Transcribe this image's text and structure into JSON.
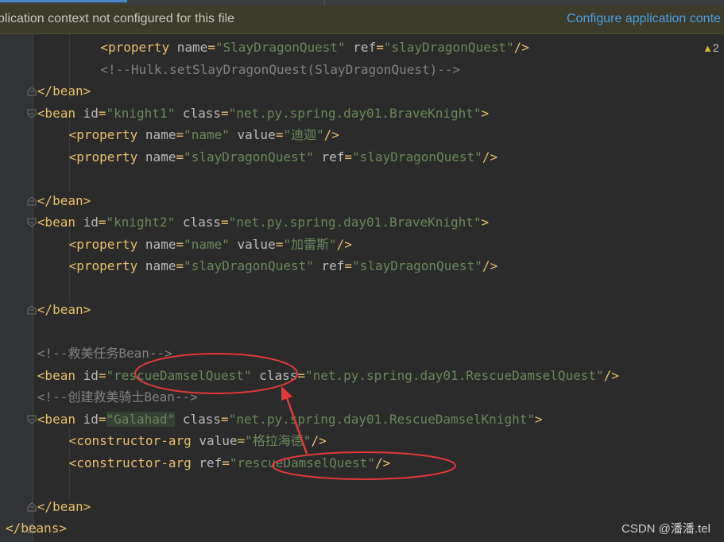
{
  "banner": {
    "message": "plication context not configured for this file",
    "action": "Configure application conte"
  },
  "inspection": {
    "count": "2",
    "icon": "warning-triangle-icon"
  },
  "code_lines": [
    {
      "indent": 6,
      "tokens": [
        [
          "tag",
          "<property "
        ],
        [
          "attr",
          "name"
        ],
        [
          "tag",
          "="
        ],
        [
          "str",
          "\"SlayDragonQuest\""
        ],
        [
          "tag",
          " "
        ],
        [
          "attr",
          "ref"
        ],
        [
          "tag",
          "="
        ],
        [
          "str",
          "\"slayDragonQuest\""
        ],
        [
          "tag",
          "/>"
        ]
      ]
    },
    {
      "indent": 6,
      "tokens": [
        [
          "cmt",
          "<!--Hulk.setSlayDragonQuest(SlayDragonQuest)-->"
        ]
      ]
    },
    {
      "indent": 2,
      "tokens": [
        [
          "tag",
          "</bean>"
        ]
      ]
    },
    {
      "indent": 2,
      "tokens": [
        [
          "tag",
          "<bean "
        ],
        [
          "attr",
          "id"
        ],
        [
          "tag",
          "="
        ],
        [
          "str",
          "\"knight1\""
        ],
        [
          "tag",
          " "
        ],
        [
          "attr",
          "class"
        ],
        [
          "tag",
          "="
        ],
        [
          "str",
          "\"net.py.spring.day01.BraveKnight\""
        ],
        [
          "tag",
          ">"
        ]
      ]
    },
    {
      "indent": 4,
      "tokens": [
        [
          "tag",
          "<property "
        ],
        [
          "attr",
          "name"
        ],
        [
          "tag",
          "="
        ],
        [
          "str",
          "\"name\""
        ],
        [
          "tag",
          " "
        ],
        [
          "attr",
          "value"
        ],
        [
          "tag",
          "="
        ],
        [
          "str",
          "\"迪迦\""
        ],
        [
          "tag",
          "/>"
        ]
      ]
    },
    {
      "indent": 4,
      "tokens": [
        [
          "tag",
          "<property "
        ],
        [
          "attr",
          "name"
        ],
        [
          "tag",
          "="
        ],
        [
          "str",
          "\"slayDragonQuest\""
        ],
        [
          "tag",
          " "
        ],
        [
          "attr",
          "ref"
        ],
        [
          "tag",
          "="
        ],
        [
          "str",
          "\"slayDragonQuest\""
        ],
        [
          "tag",
          "/>"
        ]
      ]
    },
    {
      "indent": 0,
      "tokens": []
    },
    {
      "indent": 2,
      "tokens": [
        [
          "tag",
          "</bean>"
        ]
      ]
    },
    {
      "indent": 2,
      "tokens": [
        [
          "tag",
          "<bean "
        ],
        [
          "attr",
          "id"
        ],
        [
          "tag",
          "="
        ],
        [
          "str",
          "\"knight2\""
        ],
        [
          "tag",
          " "
        ],
        [
          "attr",
          "class"
        ],
        [
          "tag",
          "="
        ],
        [
          "str",
          "\"net.py.spring.day01.BraveKnight\""
        ],
        [
          "tag",
          ">"
        ]
      ]
    },
    {
      "indent": 4,
      "tokens": [
        [
          "tag",
          "<property "
        ],
        [
          "attr",
          "name"
        ],
        [
          "tag",
          "="
        ],
        [
          "str",
          "\"name\""
        ],
        [
          "tag",
          " "
        ],
        [
          "attr",
          "value"
        ],
        [
          "tag",
          "="
        ],
        [
          "str",
          "\"加雷斯\""
        ],
        [
          "tag",
          "/>"
        ]
      ]
    },
    {
      "indent": 4,
      "tokens": [
        [
          "tag",
          "<property "
        ],
        [
          "attr",
          "name"
        ],
        [
          "tag",
          "="
        ],
        [
          "str",
          "\"slayDragonQuest\""
        ],
        [
          "tag",
          " "
        ],
        [
          "attr",
          "ref"
        ],
        [
          "tag",
          "="
        ],
        [
          "str",
          "\"slayDragonQuest\""
        ],
        [
          "tag",
          "/>"
        ]
      ]
    },
    {
      "indent": 0,
      "tokens": []
    },
    {
      "indent": 2,
      "tokens": [
        [
          "tag",
          "</bean>"
        ]
      ]
    },
    {
      "indent": 0,
      "tokens": []
    },
    {
      "indent": 2,
      "tokens": [
        [
          "cmt",
          "<!--救美任务Bean-->"
        ]
      ]
    },
    {
      "indent": 2,
      "tokens": [
        [
          "tag",
          "<bean "
        ],
        [
          "attr",
          "id"
        ],
        [
          "tag",
          "="
        ],
        [
          "str",
          "\"rescueDamselQuest\""
        ],
        [
          "tag",
          " "
        ],
        [
          "attr",
          "class"
        ],
        [
          "tag",
          "="
        ],
        [
          "str",
          "\"net.py.spring.day01.RescueDamselQuest\""
        ],
        [
          "tag",
          "/>"
        ]
      ]
    },
    {
      "indent": 2,
      "tokens": [
        [
          "cmt",
          "<!--创建救美骑士Bean-->"
        ]
      ]
    },
    {
      "indent": 2,
      "tokens": [
        [
          "tag",
          "<bean "
        ],
        [
          "attr",
          "id"
        ],
        [
          "tag",
          "="
        ],
        [
          "strhl",
          "\"Galahad\""
        ],
        [
          "tag",
          " "
        ],
        [
          "attr",
          "class"
        ],
        [
          "tag",
          "="
        ],
        [
          "str",
          "\"net.py.spring.day01.RescueDamselKnight\""
        ],
        [
          "tag",
          ">"
        ]
      ]
    },
    {
      "indent": 4,
      "tokens": [
        [
          "tag",
          "<constructor-arg "
        ],
        [
          "attr",
          "value"
        ],
        [
          "tag",
          "="
        ],
        [
          "str",
          "\"格拉海德\""
        ],
        [
          "tag",
          "/>"
        ]
      ]
    },
    {
      "indent": 4,
      "tokens": [
        [
          "tag",
          "<constructor-arg "
        ],
        [
          "attr",
          "ref"
        ],
        [
          "tag",
          "="
        ],
        [
          "str",
          "\"rescueDamselQuest\""
        ],
        [
          "tag",
          "/>"
        ]
      ]
    },
    {
      "indent": 0,
      "tokens": []
    },
    {
      "indent": 2,
      "tokens": [
        [
          "tag",
          "</bean>"
        ]
      ]
    },
    {
      "indent": 0,
      "tokens": [
        [
          "tag",
          "</beans>"
        ]
      ]
    }
  ],
  "watermark": "CSDN @潘潘.tel",
  "colors": {
    "background": "#2b2b2b",
    "gutter": "#313335",
    "tag": "#e8bf6a",
    "attribute": "#bababa",
    "string": "#6a8759",
    "comment": "#808080",
    "annotation": "#e03a3a",
    "link": "#4a9ee7"
  }
}
